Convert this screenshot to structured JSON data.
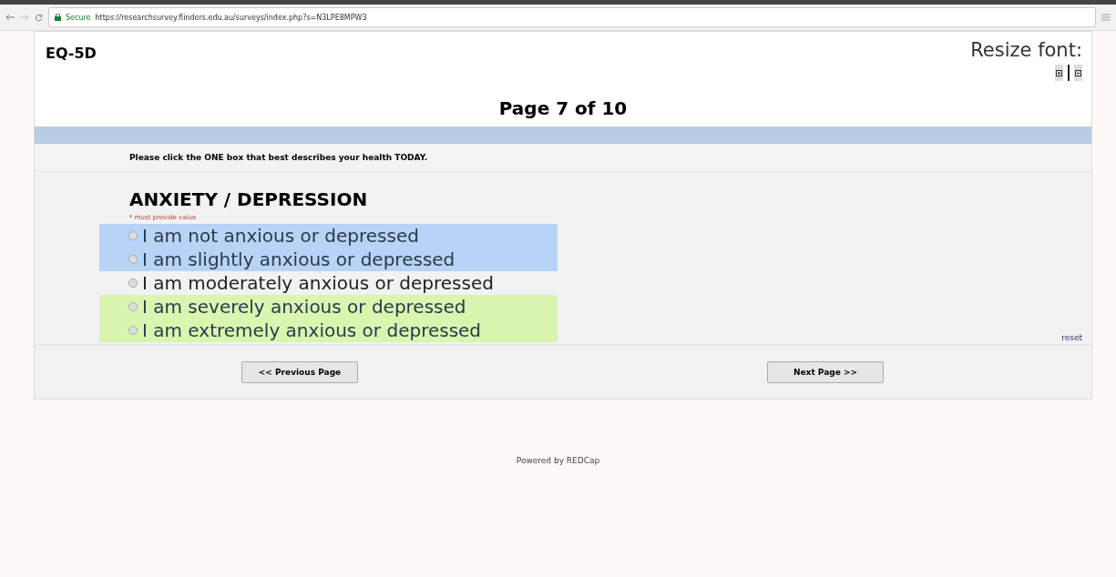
{
  "browser": {
    "security": "Secure",
    "url": "https://researchsurvey.flinders.edu.au/surveys/index.php?s=N3LPE8MPW3"
  },
  "survey": {
    "title": "EQ-5D",
    "resize_label": "Resize font:",
    "page": "Page 7 of 10"
  },
  "instruction": "Please click the ONE box that best describes your health TODAY.",
  "question": {
    "title": "ANXIETY / DEPRESSION",
    "required": "* must provide value",
    "options": [
      {
        "label": "I am not anxious or depressed",
        "selected": false,
        "color": "#b7d3f5"
      },
      {
        "label": "I am slightly anxious or depressed",
        "selected": false,
        "color": "#b7d3f5"
      },
      {
        "label": "I am moderately anxious or depressed",
        "selected": false
      },
      {
        "label": "I am severely anxious or depressed",
        "selected": false,
        "color": "#d9f5b0"
      },
      {
        "label": "I am extremely anxious or depressed",
        "selected": false,
        "color": "#d9f5b0"
      }
    ],
    "reset": "reset"
  },
  "nav": {
    "previous": "<< Previous Page",
    "next": "Next Page >>"
  },
  "footer": "Powered by REDCap"
}
